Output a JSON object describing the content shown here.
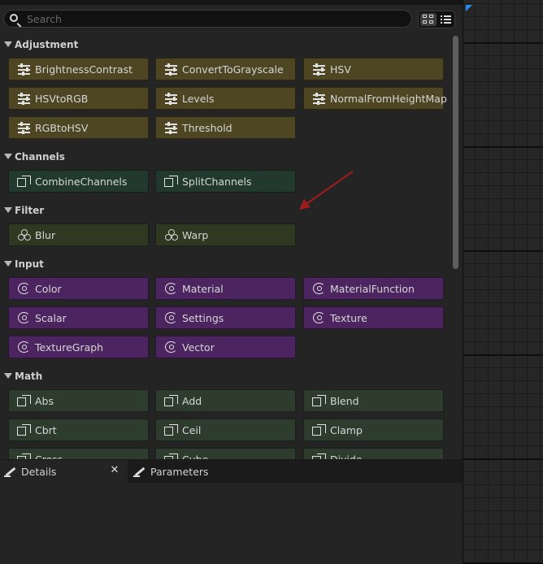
{
  "search": {
    "placeholder": "Search"
  },
  "categories": [
    {
      "name": "Adjustment",
      "color": "#4e4522",
      "icon": "sliders-icon",
      "nodes": [
        "BrightnessContrast",
        "ConvertToGrayscale",
        "HSV",
        "HSVtoRGB",
        "Levels",
        "NormalFromHeightMap",
        "RGBtoHSV",
        "Threshold"
      ]
    },
    {
      "name": "Channels",
      "color": "#22392f",
      "icon": "cube-icon",
      "nodes": [
        "CombineChannels",
        "SplitChannels"
      ]
    },
    {
      "name": "Filter",
      "color": "#2f3922",
      "icon": "circles-icon",
      "nodes": [
        "Blur",
        "Warp"
      ]
    },
    {
      "name": "Input",
      "color": "#4c2560",
      "icon": "swirl-icon",
      "nodes": [
        "Color",
        "Material",
        "MaterialFunction",
        "Scalar",
        "Settings",
        "Texture",
        "TextureGraph",
        "Vector"
      ]
    },
    {
      "name": "Math",
      "color": "#2d3c2c",
      "icon": "cube-icon",
      "nodes": [
        "Abs",
        "Add",
        "Blend",
        "Cbrt",
        "Ceil",
        "Clamp",
        "Cross",
        "Cube",
        "Divide"
      ]
    }
  ],
  "tabs": [
    {
      "label": "Details",
      "icon": "pencil-icon",
      "active": true
    },
    {
      "label": "Parameters",
      "icon": "pencil-icon",
      "active": false
    }
  ],
  "annotation": {
    "color": "#a01d1d"
  },
  "graph": {
    "selection_color": "#2a8cf0"
  }
}
